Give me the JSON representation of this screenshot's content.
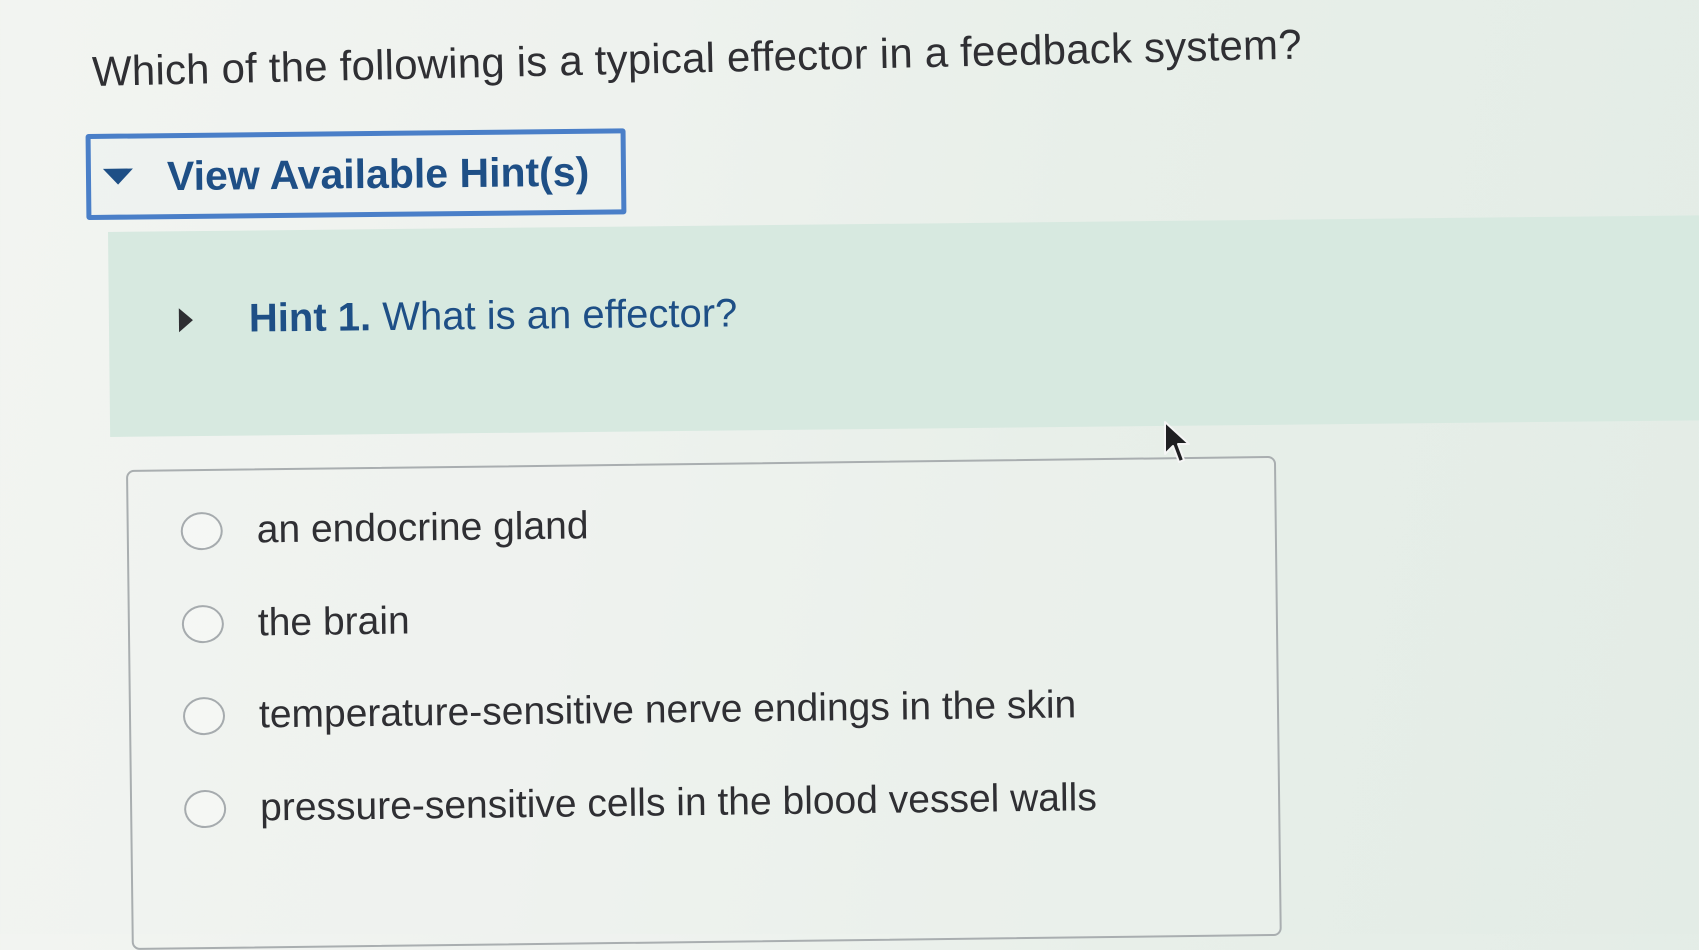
{
  "question": {
    "text": "Which of the following is a typical effector in a feedback system?"
  },
  "hints": {
    "toggle_label": "View Available Hint(s)",
    "items": [
      {
        "number_label": "Hint 1.",
        "text": "What is an effector?"
      }
    ]
  },
  "options": [
    {
      "label": "an endocrine gland"
    },
    {
      "label": "the brain"
    },
    {
      "label": "temperature-sensitive nerve endings in the skin"
    },
    {
      "label": "pressure-sensitive cells in the blood vessel walls"
    }
  ],
  "colors": {
    "accent": "#1e4f86",
    "toggle_border": "#4a7fc8",
    "hint_panel": "#d7e9e0"
  },
  "icons": {
    "hint_toggle": "caret-down-icon",
    "hint_item": "caret-right-icon",
    "option": "radio-icon",
    "pointer": "mouse-pointer-icon"
  }
}
